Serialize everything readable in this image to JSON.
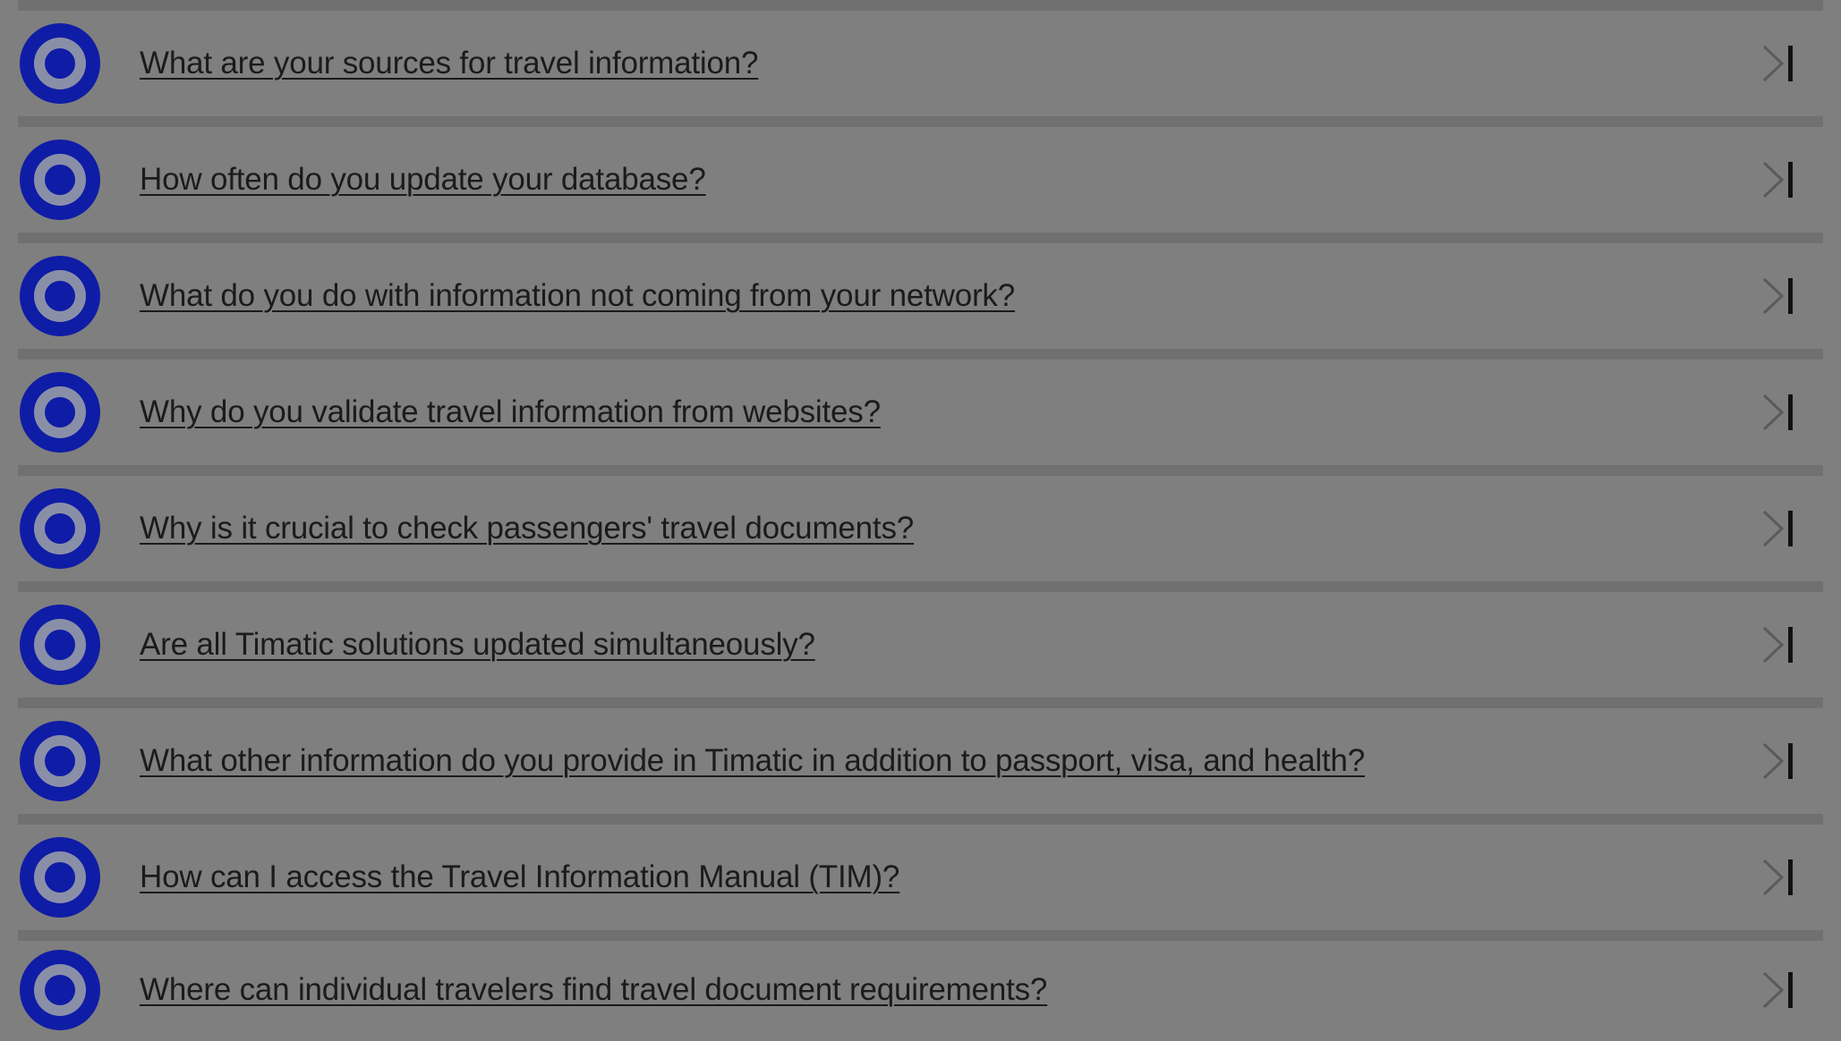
{
  "colors": {
    "overlay_background": "#7f7f7f",
    "divider": "#707070",
    "icon_blue": "#0f1ca6",
    "icon_inner": "#8a8fa8",
    "text": "#1b1b1b"
  },
  "faq": {
    "items": [
      {
        "question": "What are your sources for travel information?",
        "icon": "target-icon",
        "action_icon": "chevron-right-bar-icon"
      },
      {
        "question": "How often do you update your database?",
        "icon": "target-icon",
        "action_icon": "chevron-right-bar-icon"
      },
      {
        "question": "What do you do with information not coming from your network?",
        "icon": "target-icon",
        "action_icon": "chevron-right-bar-icon"
      },
      {
        "question": "Why do you validate travel information from websites?",
        "icon": "target-icon",
        "action_icon": "chevron-right-bar-icon"
      },
      {
        "question": "Why is it crucial to check passengers' travel documents?",
        "icon": "target-icon",
        "action_icon": "chevron-right-bar-icon"
      },
      {
        "question": "Are all Timatic solutions updated simultaneously?",
        "icon": "target-icon",
        "action_icon": "chevron-right-bar-icon"
      },
      {
        "question": "What other information do you provide in Timatic in addition to passport, visa, and health?",
        "icon": "target-icon",
        "action_icon": "chevron-right-bar-icon"
      },
      {
        "question": "How can I access the Travel Information Manual (TIM)?",
        "icon": "target-icon",
        "action_icon": "chevron-right-bar-icon"
      },
      {
        "question": "Where can individual travelers find travel document requirements?",
        "icon": "target-icon",
        "action_icon": "chevron-right-bar-icon"
      }
    ]
  }
}
